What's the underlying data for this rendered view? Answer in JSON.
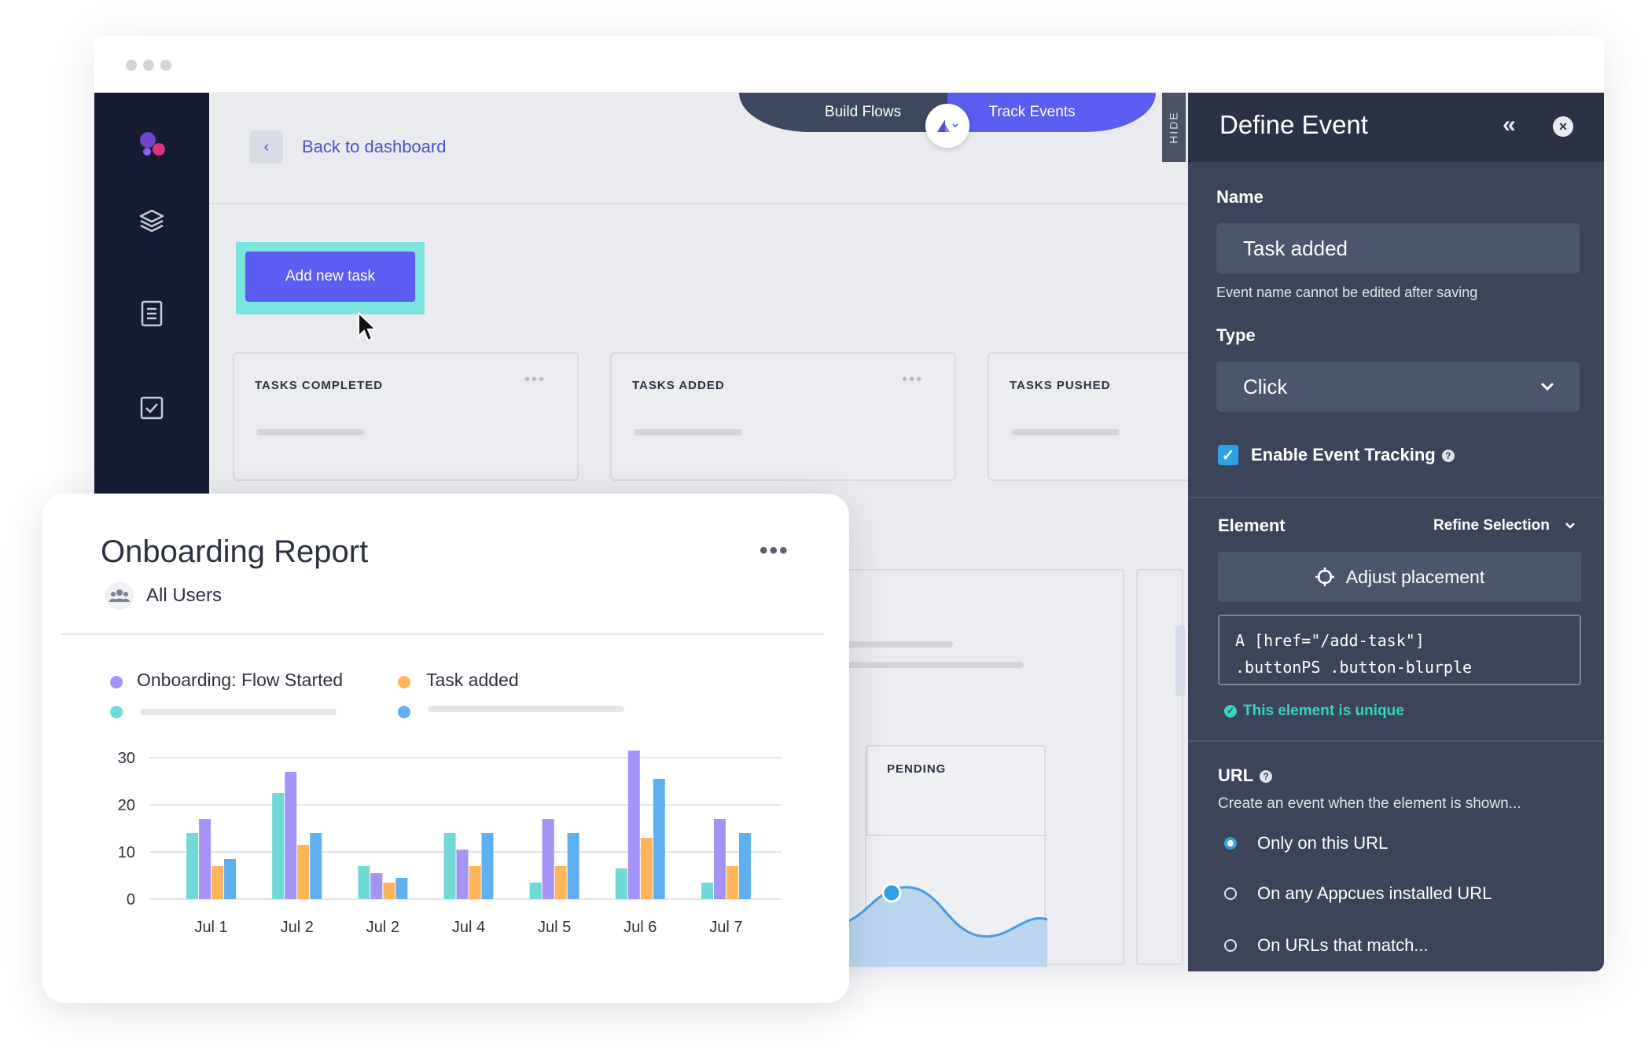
{
  "topbar": {
    "back_label": "Back to dashboard"
  },
  "mode_tabs": {
    "build": "Build Flows",
    "track": "Track Events",
    "hide": "HIDE"
  },
  "main": {
    "add_task_label": "Add new task",
    "cards": [
      {
        "title": "TASKS COMPLETED"
      },
      {
        "title": "TASKS ADDED"
      },
      {
        "title": "TASKS PUSHED"
      }
    ],
    "pending_label": "PENDING"
  },
  "panel": {
    "title": "Define Event",
    "name_label": "Name",
    "name_value": "Task added",
    "name_hint": "Event name cannot be edited after saving",
    "type_label": "Type",
    "type_value": "Click",
    "tracking_label": "Enable Event Tracking",
    "element_label": "Element",
    "refine_label": "Refine Selection",
    "adjust_label": "Adjust placement",
    "selector_line1": "A [href=\"/add-task\"]",
    "selector_line2": ".buttonPS .button-blurple",
    "unique_label": "This element is unique",
    "url_label": "URL",
    "url_hint": "Create an event when the element is shown...",
    "url_options": [
      "Only on this URL",
      "On any Appcues installed URL",
      "On URLs that match..."
    ]
  },
  "report": {
    "title": "Onboarding Report",
    "audience": "All Users",
    "legend": [
      "Onboarding: Flow Started",
      "Task added"
    ]
  },
  "chart_data": {
    "type": "bar",
    "categories": [
      "Jul 1",
      "Jul 2",
      "Jul 2",
      "Jul 4",
      "Jul 5",
      "Jul 6",
      "Jul 7"
    ],
    "ylim": [
      0,
      30
    ],
    "yticks": [
      0,
      10,
      20,
      30
    ],
    "series": [
      {
        "color": "#6fdad6",
        "values": [
          14,
          22.5,
          7,
          14,
          3.5,
          6.5,
          3.5
        ]
      },
      {
        "name": "Onboarding: Flow Started",
        "color": "#a594f5",
        "values": [
          17,
          27,
          5.5,
          10.5,
          17,
          31.5,
          17
        ]
      },
      {
        "name": "Task added",
        "color": "#ffb65a",
        "values": [
          7,
          11.5,
          3.5,
          7,
          7,
          13,
          7
        ]
      },
      {
        "color": "#5fb0f3",
        "values": [
          8.5,
          14,
          4.5,
          14,
          14,
          25.5,
          14
        ]
      }
    ]
  }
}
